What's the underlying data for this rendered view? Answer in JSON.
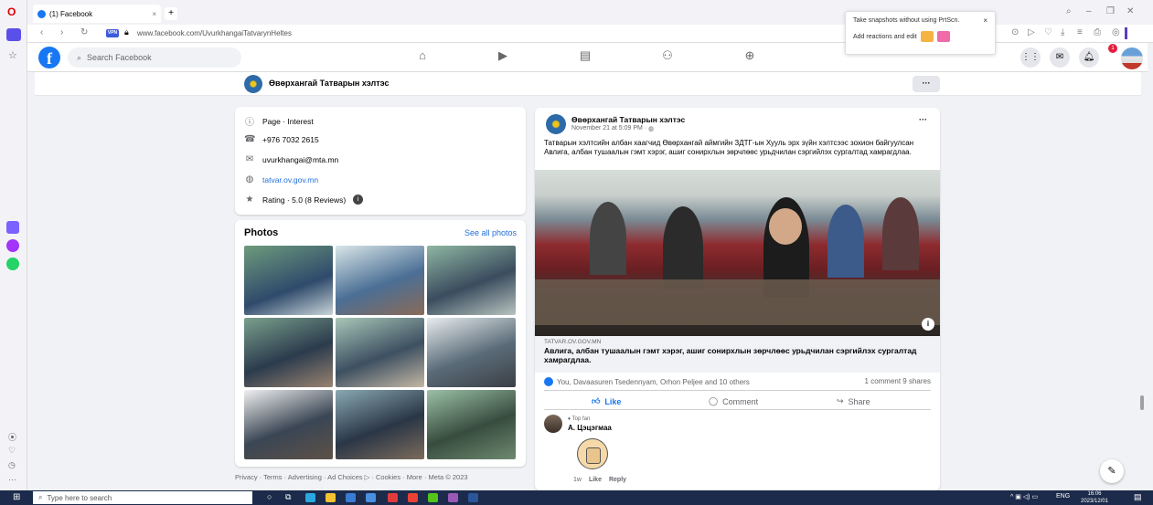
{
  "browser": {
    "tab_title": "(1) Facebook",
    "url": "www.facebook.com/UvurkhangaiTatvarynHeltes",
    "vpn_label": "VPN",
    "accent": "#3b5bdb"
  },
  "popup": {
    "line1": "Take snapshots without using PrtScn.",
    "line2": "Add reactions and edit"
  },
  "fb": {
    "search_placeholder": "Search Facebook",
    "notification_count": "1",
    "brand_color": "#1877f2"
  },
  "page": {
    "name": "Өвөрхангай Татварын хэлтэс"
  },
  "intro": {
    "rows": [
      {
        "icon": "info-icon",
        "text": "Page · Interest"
      },
      {
        "icon": "phone-icon",
        "text": "+976 7032 2615"
      },
      {
        "icon": "email-icon",
        "text": "uvurkhangai@mta.mn"
      },
      {
        "icon": "globe-icon",
        "text": "tatvar.ov.gov.mn"
      },
      {
        "icon": "star-icon",
        "text": "Rating · 5.0 (8 Reviews)"
      }
    ]
  },
  "photos": {
    "title": "Photos",
    "see_all": "See all photos"
  },
  "footer": "Privacy · Terms · Advertising · Ad Choices ▷ · Cookies · More · Meta © 2023",
  "post": {
    "author": "Өвөрхангай Татварын хэлтэс",
    "time": "November 21 at 5:09 PM · ",
    "text": "Татварын хэлтсийн албан хаагчид Өвөрхангай аймгийн ЗДТГ-ын Хууль эрх зүйн хэлтсээс зохион байгуулсан Авлига, албан тушаалын гэмт хэрэг, ашиг сонирхлын зөрчлөөс урьдчилан сэргийлэх сургалтад хамрагдлаа.",
    "link_domain": "TATVAR.OV.GOV.MN",
    "link_title": "Авлига, албан тушаалын гэмт хэрэг, ашиг сонирхлын зөрчлөөс урьдчилан сэргийлэх сургалтад хамрагдлаа.",
    "reactions": "You, Davaasuren Tsedennyam, Orhon Peljee and 10 others",
    "counts": "1 comment  9 shares",
    "like": "Like",
    "comment": "Comment",
    "share": "Share"
  },
  "comment": {
    "badge": "Top fan",
    "author": "А. Цэцэгмаа",
    "time": "1w",
    "like": "Like",
    "reply": "Reply"
  },
  "taskbar": {
    "search_placeholder": "Type here to search",
    "lang": "ENG",
    "time": "16:06",
    "date": "2023/12/01"
  }
}
